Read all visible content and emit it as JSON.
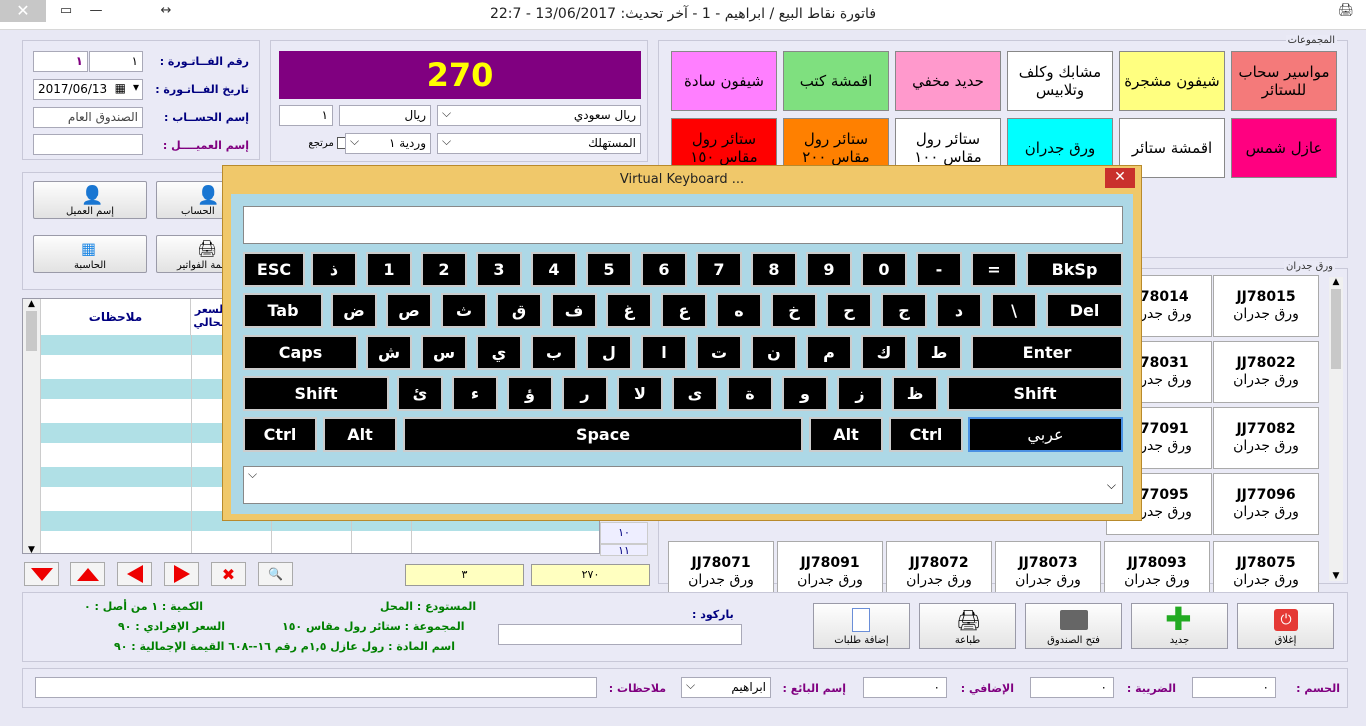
{
  "window": {
    "title": "فاتورة نقاط البيع / ابراهيم - 1 - آخر تحديث: 13/06/2017 - 22:7"
  },
  "invoice": {
    "number_label": "رقم الفــاتـورة :",
    "number_value": "١",
    "number_box2": "١",
    "date_label": "تاريخ الفــاتـورة :",
    "date_value": "2017/06/13",
    "account_label": "إسم الحســاب :",
    "account_value": "الصندوق العام",
    "client_label": "إسم العميــــل :",
    "client_value": ""
  },
  "total": {
    "value": "270"
  },
  "currency": {
    "unit_value": "١",
    "unit_name": "ريال",
    "currency_select": "ريال سعودي",
    "shift_select": "وردية ١",
    "customer_type": "المستهلك",
    "returned_label": "مرتجع"
  },
  "left_buttons": [
    {
      "label": "إسم العميل",
      "icon": "person-icon"
    },
    {
      "label": "الحساب",
      "icon": "person-icon"
    },
    {
      "label": "الحاسبة",
      "icon": "calculator-icon"
    },
    {
      "label": "قائمة الفواتير",
      "icon": "printer-icon"
    }
  ],
  "grid": {
    "col_notes": "ملاحظات",
    "col_price": "السعر الحالي",
    "row_numbers": [
      "١٠",
      "١١"
    ]
  },
  "groups_label": "المجموعات",
  "groups": [
    {
      "label": "مواسير سحاب للستائر",
      "color": "#f47a7a"
    },
    {
      "label": "شيفون مشجرة",
      "color": "#ffff80"
    },
    {
      "label": "مشابك وكلف وتلابيس",
      "color": "#ffffff"
    },
    {
      "label": "حديد مخفي",
      "color": "#ff99cc"
    },
    {
      "label": "اقمشة كتب",
      "color": "#7fe07f"
    },
    {
      "label": "شيفون سادة",
      "color": "#ff7fff"
    },
    {
      "label": "عازل شمس",
      "color": "#ff0080"
    },
    {
      "label": "اقمشة ستائر",
      "color": "#ffffff"
    },
    {
      "label": "ورق جدران",
      "color": "#00ffff"
    },
    {
      "label": "ستائر رول مقاس ١٠٠",
      "color": "#ffffff"
    },
    {
      "label": "ستائر رول مقاس ٢٠٠",
      "color": "#ff8000"
    },
    {
      "label": "ستائر رول مقاس ١٥٠",
      "color": "#ff0000"
    }
  ],
  "items_label": "ورق جدران",
  "items_right": [
    {
      "code": "JJ78015",
      "name": "ورق جدران"
    },
    {
      "code": "JJ78022",
      "name": "ورق جدران"
    },
    {
      "code": "JJ77082",
      "name": "ورق جدران"
    },
    {
      "code": "JJ77096",
      "name": "ورق جدران"
    }
  ],
  "items_second": [
    {
      "code": "JJ78014",
      "name": "ورق جدران"
    },
    {
      "code": "JJ78031",
      "name": "ورق جدران"
    },
    {
      "code": "JJ77091",
      "name": "ورق جدران"
    },
    {
      "code": "JJ77095",
      "name": "ورق جدران"
    }
  ],
  "items_bottom": [
    {
      "code": "JJ78075",
      "name": "ورق جدران"
    },
    {
      "code": "JJ78093",
      "name": "ورق جدران"
    },
    {
      "code": "JJ78073",
      "name": "ورق جدران"
    },
    {
      "code": "JJ78072",
      "name": "ورق جدران"
    },
    {
      "code": "JJ78091",
      "name": "ورق جدران"
    },
    {
      "code": "JJ78071",
      "name": "ورق جدران"
    }
  ],
  "summary": {
    "count_value": "٣",
    "total_value": "٢٧٠"
  },
  "info": {
    "qty": "الكمية : ١ من أصل : ٠",
    "price": "السعر الإفرادي : ٩٠",
    "total": "اسم المادة : رول عازل ١,٥م رقم ١٦--٦٠٨ القيمة الإجمالية : ٩٠",
    "warehouse": "المستودع : المحل",
    "group": "المجموعة : ستائر رول مقاس ١٥٠",
    "barcode_label": "باركود :"
  },
  "actions": [
    {
      "label": "إغلاق",
      "icon": "power-icon"
    },
    {
      "label": "جديد",
      "icon": "plus-icon"
    },
    {
      "label": "فتح الصندوق",
      "icon": "cashbox-icon"
    },
    {
      "label": "طباعة",
      "icon": "printer-icon"
    },
    {
      "label": "إضافة طلبات",
      "icon": "document-icon"
    }
  ],
  "footer": {
    "discount_label": "الحسم :",
    "tax_label": "الضريبة :",
    "extra_label": "الإضافي :",
    "seller_label": "إسم البائع :",
    "seller_value": "ابراهيم",
    "notes_label": "ملاحظات :",
    "zero": "٠"
  },
  "keyboard": {
    "title": "Virtual Keyboard ...",
    "row1": [
      "ESC",
      "ذ",
      "1",
      "2",
      "3",
      "4",
      "5",
      "6",
      "7",
      "8",
      "9",
      "0",
      "-",
      "=",
      "BkSp"
    ],
    "row2": [
      "Tab",
      "ض",
      "ص",
      "ث",
      "ق",
      "ف",
      "غ",
      "ع",
      "ه",
      "خ",
      "ح",
      "ج",
      "د",
      "\\",
      "Del"
    ],
    "row3": [
      "Caps",
      "ش",
      "س",
      "ي",
      "ب",
      "ل",
      "ا",
      "ت",
      "ن",
      "م",
      "ك",
      "ط",
      "Enter"
    ],
    "row4": [
      "Shift",
      "ئ",
      "ء",
      "ؤ",
      "ر",
      "لا",
      "ى",
      "ة",
      "و",
      "ز",
      "ظ",
      "Shift"
    ],
    "row5": [
      "Ctrl",
      "Alt",
      "Space",
      "Alt",
      "Ctrl",
      "عربي"
    ]
  }
}
